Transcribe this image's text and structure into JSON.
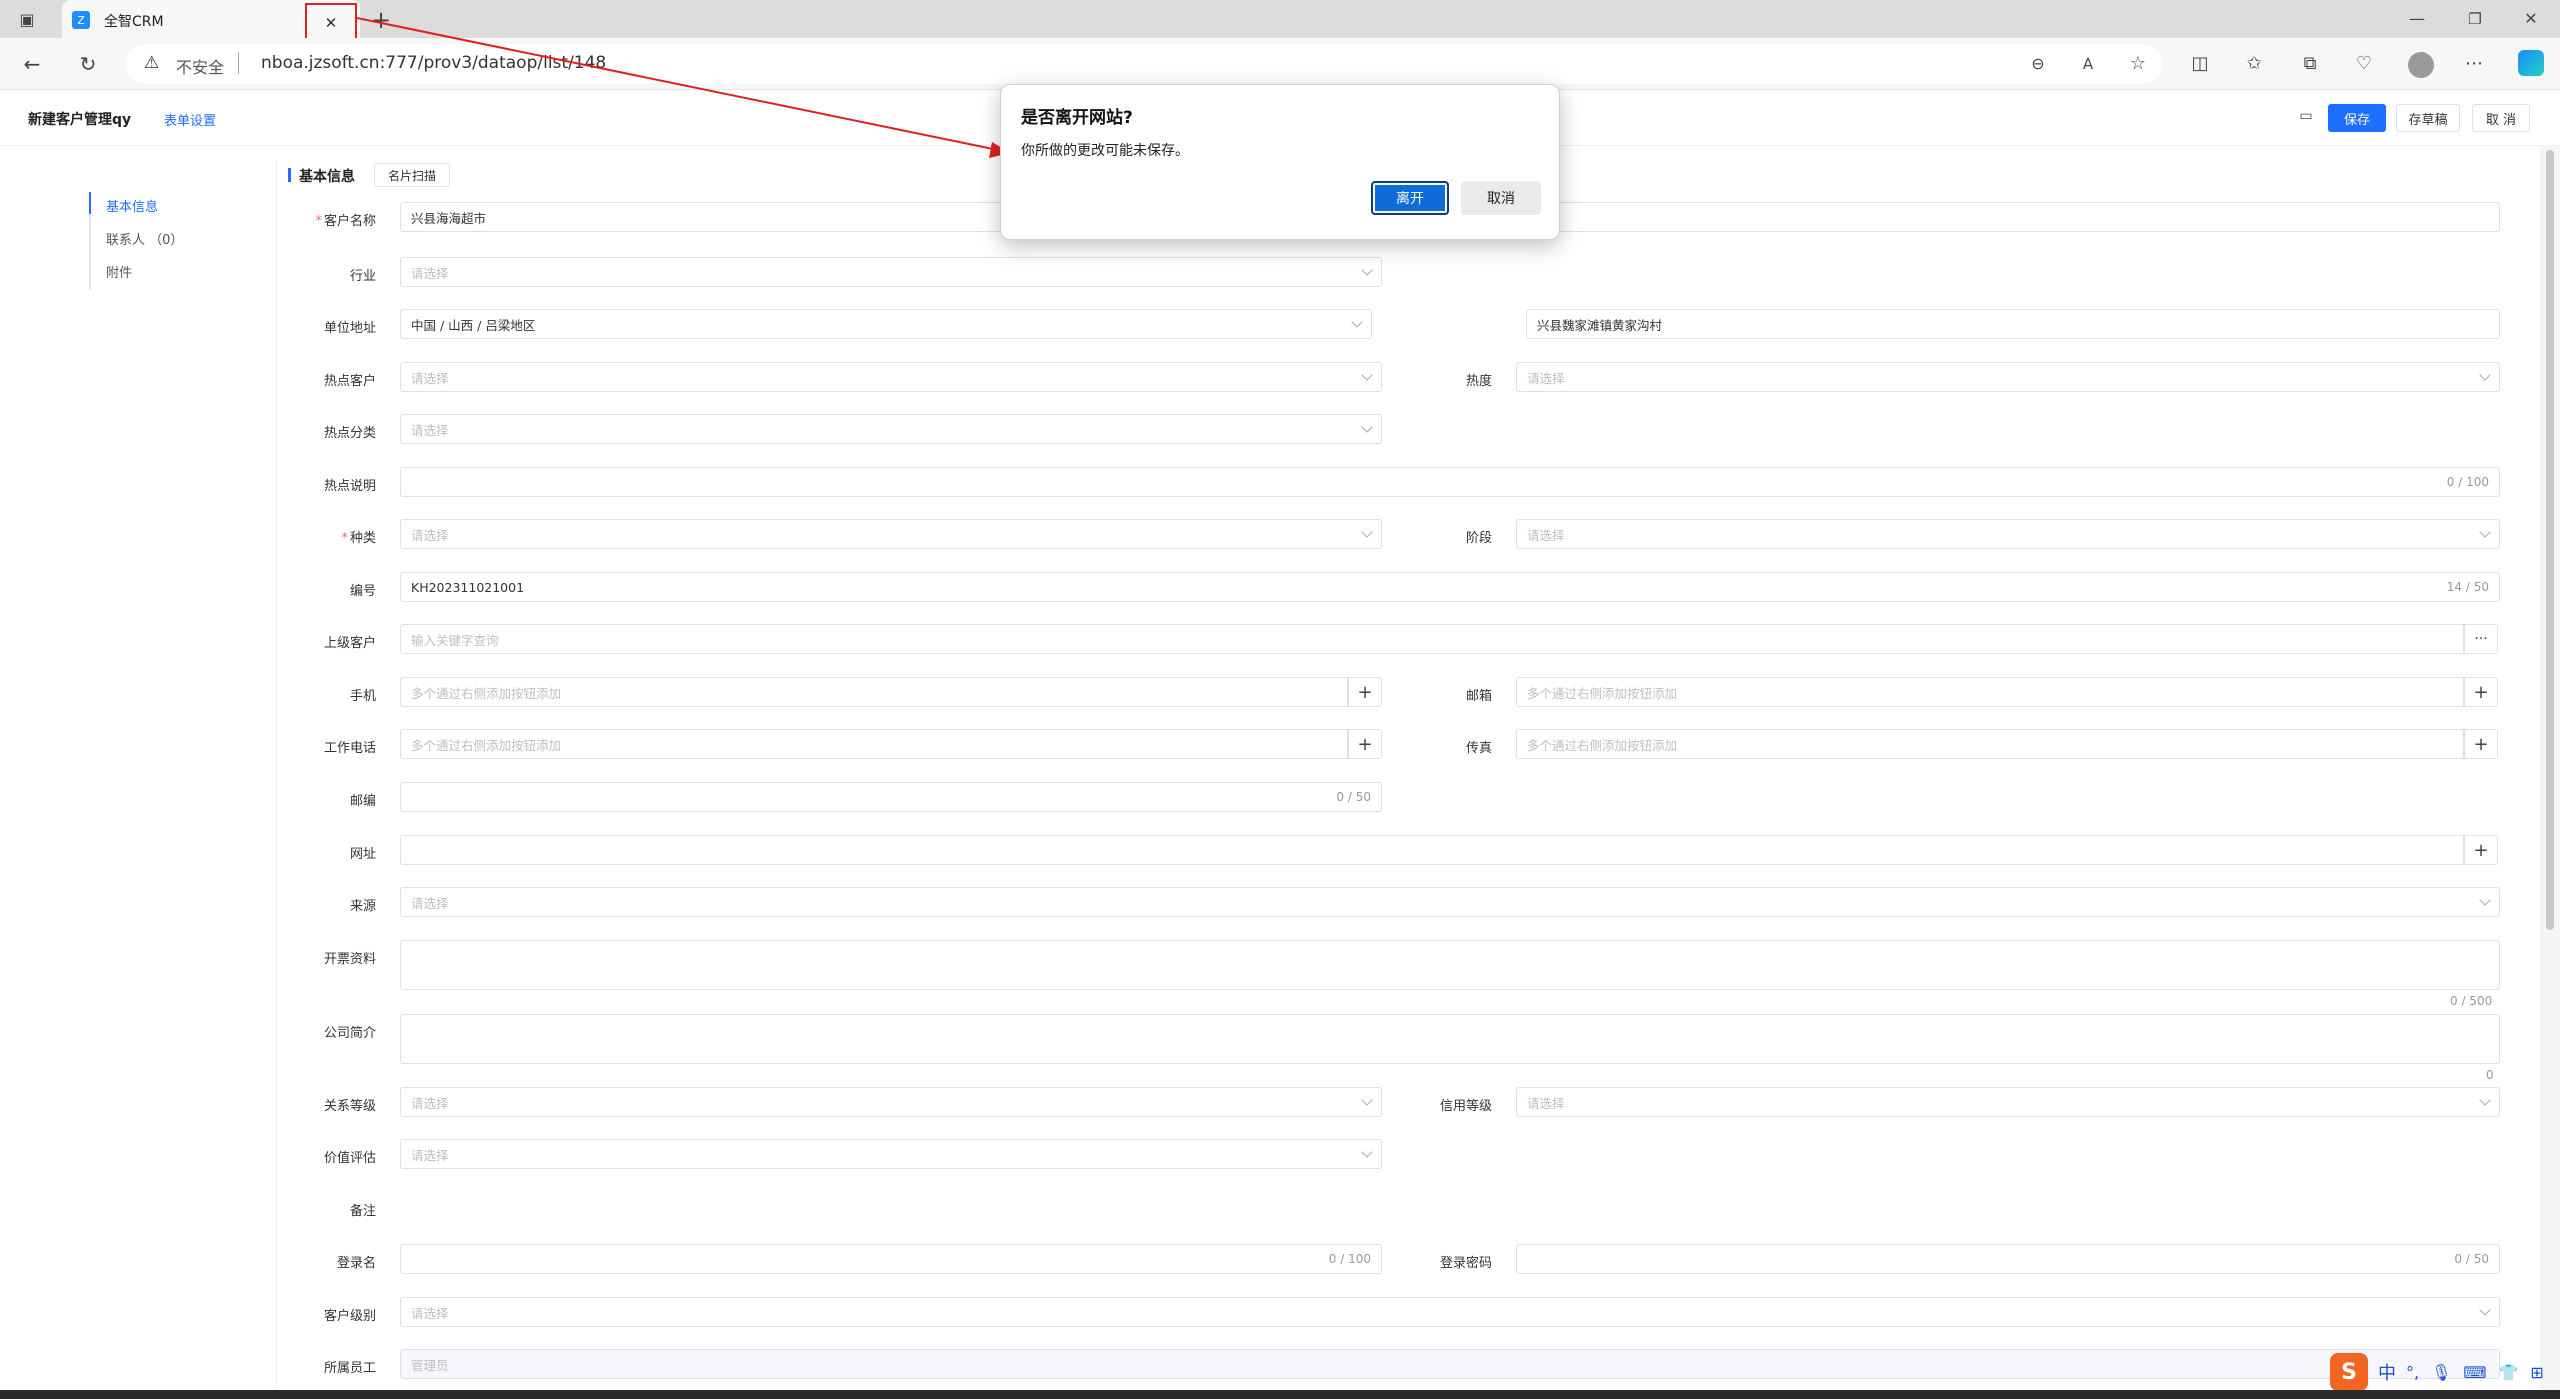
{
  "browser": {
    "tab_title": "全智CRM",
    "tab_close": "✕",
    "new_tab": "+",
    "security_label": "不安全",
    "url": "nboa.jzsoft.cn:777/prov3/dataop/list/148"
  },
  "header": {
    "page_title": "新建客户管理qy",
    "form_settings": "表单设置",
    "save": "保存",
    "save_draft": "存草稿",
    "cancel": "取 消"
  },
  "nav": {
    "items": [
      {
        "label": "基本信息"
      },
      {
        "label": "联系人 （0）"
      },
      {
        "label": "附件"
      }
    ]
  },
  "section": {
    "title": "基本信息",
    "card_scan": "名片扫描"
  },
  "placeholders": {
    "select": "请选择",
    "keyword": "输入关键字查询",
    "multi": "多个通过右侧添加按钮添加",
    "more": "···"
  },
  "fields": {
    "customer_name": {
      "label": "客户名称",
      "value": "兴县海海超市"
    },
    "industry": {
      "label": "行业"
    },
    "address": {
      "label": "单位地址",
      "region": "中国 / 山西 / 吕梁地区",
      "detail": "兴县魏家滩镇黄家沟村"
    },
    "hot_customer": {
      "label": "热点客户"
    },
    "heat": {
      "label": "热度"
    },
    "hot_category": {
      "label": "热点分类"
    },
    "hot_desc": {
      "label": "热点说明",
      "count": "0 / 100"
    },
    "kind": {
      "label": "种类"
    },
    "stage": {
      "label": "阶段"
    },
    "code": {
      "label": "编号",
      "value": "KH202311021001",
      "count": "14 / 50"
    },
    "parent_customer": {
      "label": "上级客户"
    },
    "mobile": {
      "label": "手机"
    },
    "email": {
      "label": "邮箱"
    },
    "work_phone": {
      "label": "工作电话"
    },
    "fax": {
      "label": "传真"
    },
    "postcode": {
      "label": "邮编",
      "count": "0 / 50"
    },
    "website": {
      "label": "网址"
    },
    "source": {
      "label": "来源"
    },
    "invoice": {
      "label": "开票资料",
      "count": "0 / 500"
    },
    "intro": {
      "label": "公司简介",
      "count": "0"
    },
    "relation_level": {
      "label": "关系等级"
    },
    "credit_level": {
      "label": "信用等级"
    },
    "value_eval": {
      "label": "价值评估"
    },
    "remark": {
      "label": "备注"
    },
    "login_name": {
      "label": "登录名",
      "count": "0 / 100"
    },
    "login_pwd": {
      "label": "登录密码",
      "count": "0 / 50"
    },
    "customer_level": {
      "label": "客户级别"
    },
    "owner": {
      "label": "所属员工",
      "value": "管理员"
    }
  },
  "dialog": {
    "title": "是否离开网站?",
    "message": "你所做的更改可能未保存。",
    "leave": "离开",
    "cancel": "取消"
  },
  "ime": {
    "lang": "中"
  },
  "colors": {
    "primary": "#1f6fff",
    "annotation": "#e02020",
    "required": "#f56c6c"
  }
}
